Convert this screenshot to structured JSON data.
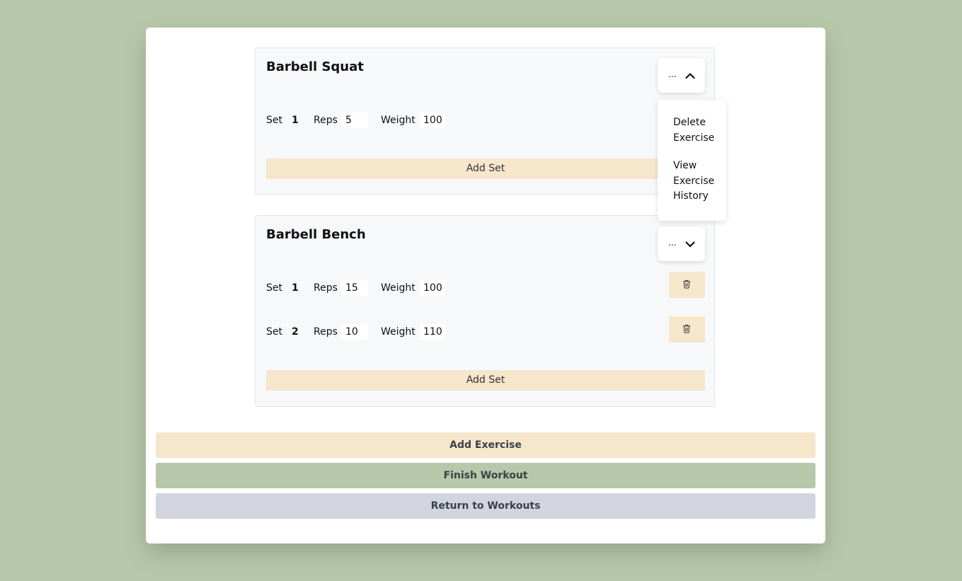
{
  "exercises": [
    {
      "name": "Barbell Squat",
      "menu_dots": "...",
      "sets": [
        {
          "set_label": "Set",
          "set_number": "1",
          "reps_label": "Reps",
          "reps": "5",
          "weight_label": "Weight",
          "weight": "100"
        }
      ],
      "add_set_label": "Add Set"
    },
    {
      "name": "Barbell Bench",
      "menu_dots": "...",
      "sets": [
        {
          "set_label": "Set",
          "set_number": "1",
          "reps_label": "Reps",
          "reps": "15",
          "weight_label": "Weight",
          "weight": "100"
        },
        {
          "set_label": "Set",
          "set_number": "2",
          "reps_label": "Reps",
          "reps": "10",
          "weight_label": "Weight",
          "weight": "110"
        }
      ],
      "add_set_label": "Add Set"
    }
  ],
  "dropdown": {
    "delete_label": "Delete Exercise",
    "history_label": "View Exercise History"
  },
  "actions": {
    "add_exercise": "Add Exercise",
    "finish_workout": "Finish Workout",
    "return_to_workouts": "Return to Workouts"
  },
  "colors": {
    "background": "#b7c8aa",
    "add_accent": "#f5e6cc",
    "finish_accent": "#b7c8aa",
    "return_accent": "#d2d5dd"
  },
  "icons": {
    "menu_open": "chevron-up-icon",
    "menu_closed": "chevron-down-icon",
    "delete_set": "trash-icon"
  }
}
